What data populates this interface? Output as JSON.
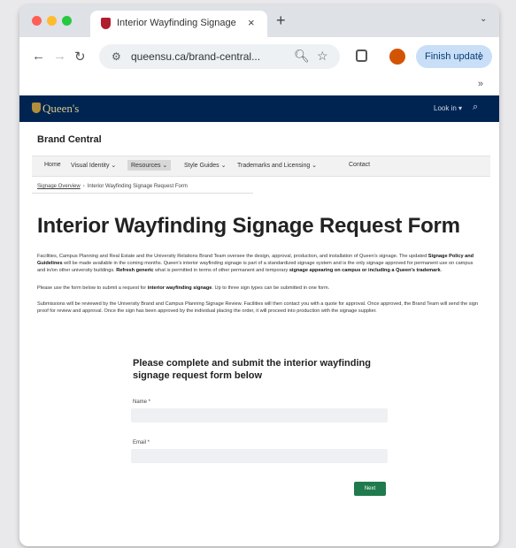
{
  "browser": {
    "tab_title": "Interior Wayfinding Signage R",
    "tab_close": "×",
    "new_tab": "+",
    "tab_menu": "⌄",
    "url": "queensu.ca/brand-central...",
    "finish_update_label": "Finish update",
    "finish_update_menu": "⋮",
    "profile_initial": "",
    "bookmarks_chevron": "»"
  },
  "site": {
    "logo_text": "Queen's",
    "sign_in": "Look in ▾",
    "site_name": "Brand Central",
    "nav": [
      {
        "label": "Home"
      },
      {
        "label": "Visual Identity ⌄"
      },
      {
        "label": "Resources ⌄"
      },
      {
        "label": "Style Guides ⌄"
      },
      {
        "label": "Trademarks and Licensing ⌄"
      },
      {
        "label": "Contact"
      }
    ],
    "breadcrumb": {
      "parent": "Signage Overview",
      "separator": "›",
      "current": "Interior Wayfinding Signage Request Form"
    }
  },
  "content": {
    "title": "Interior Wayfinding Signage Request Form",
    "p1_a": "Facilities, Campus Planning and Real Estate and the University Relations Brand Team oversee the design, approval, production, and installation of Queen's signage. The updated ",
    "p1_b": "Signage Policy and Guidelines",
    "p1_c": " will be made available in the coming months. Queen's interior wayfinding signage is part of a standardized signage system and is the only signage approved for permanent use on campus and in/on other university buildings. ",
    "p1_d": "Refresh generic",
    "p1_e": " what is permitted in terms of other permanent and temporary ",
    "p1_f": "signage appearing on campus or including a Queen's trademark",
    "p1_g": ".",
    "p2_a": "Please use the form below to submit a request for ",
    "p2_b": "interior wayfinding signage",
    "p2_c": ". Up to three sign types can be submitted in one form.",
    "p3": "Submissions will be reviewed by the University Brand and Campus Planning Signage Review. Facilities will then contact you with a quote for approval. Once approved, the Brand Team will send the sign proof for review and approval. Once the sign has been approved by the individual placing the order, it will proceed into production with the signage supplier.",
    "form_heading": "Please complete and submit the interior wayfinding signage request form below",
    "name_label": "Name *",
    "email_label": "Email *",
    "next_label": "Next"
  }
}
